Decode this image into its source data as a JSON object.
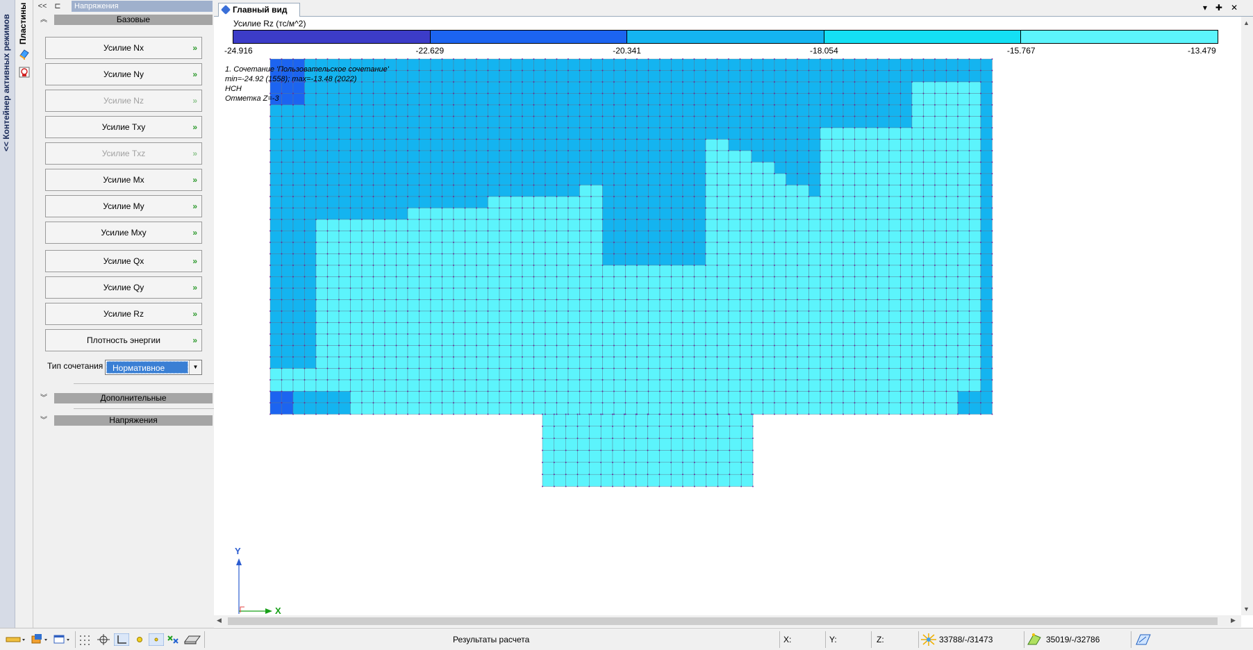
{
  "container_strip": {
    "label": "<< Контейнер активных режимов"
  },
  "mode_strip": {
    "label": "Пластины"
  },
  "panel": {
    "title": "Напряжения",
    "sections": {
      "base": "Базовые",
      "extra": "Дополнительные",
      "stress": "Напряжения"
    },
    "buttons": [
      {
        "label": "Усилие Nx",
        "enabled": true
      },
      {
        "label": "Усилие Ny",
        "enabled": true
      },
      {
        "label": "Усилие Nz",
        "enabled": false
      },
      {
        "label": "Усилие Txy",
        "enabled": true
      },
      {
        "label": "Усилие Txz",
        "enabled": false
      },
      {
        "label": "Усилие Mx",
        "enabled": true
      },
      {
        "label": "Усилие My",
        "enabled": true
      },
      {
        "label": "Усилие Mxy",
        "enabled": true
      },
      {
        "label": "Усилие Qx",
        "enabled": true
      },
      {
        "label": "Усилие Qy",
        "enabled": true
      },
      {
        "label": "Усилие Rz",
        "enabled": true
      },
      {
        "label": "Плотность энергии",
        "enabled": true
      }
    ],
    "arrow_glyph": "»",
    "combo_label": "Тип сочетания",
    "combo_value": "Нормативное"
  },
  "view": {
    "tab_label": "Главный вид",
    "legend_title": "Усилие Rz (тс/м^2)",
    "legend_ticks": [
      "-24.916",
      "-22.629",
      "-20.341",
      "-18.054",
      "-15.767",
      "-13.479"
    ],
    "legend_colors": [
      "#3c3cc8",
      "#1c64f0",
      "#14b4f0",
      "#14e0f4",
      "#5cf4fc"
    ],
    "info_lines": [
      "1. Сочетание 'Пользовательское сочетание'",
      "min=-24.92 (1558); max=-13.48 (2022)",
      "НСН",
      "Отметка Z=-3"
    ],
    "axis_x": "X",
    "axis_y": "Y"
  },
  "status": {
    "center_text": "Результаты расчета",
    "x_label": "X:",
    "y_label": "Y:",
    "z_label": "Z:",
    "nodes": "33788/-/31473",
    "elements": "35019/-/32786"
  },
  "icons": {
    "tab": "view-icon",
    "status_nodes": "nodes-icon",
    "status_elements": "elements-icon"
  }
}
